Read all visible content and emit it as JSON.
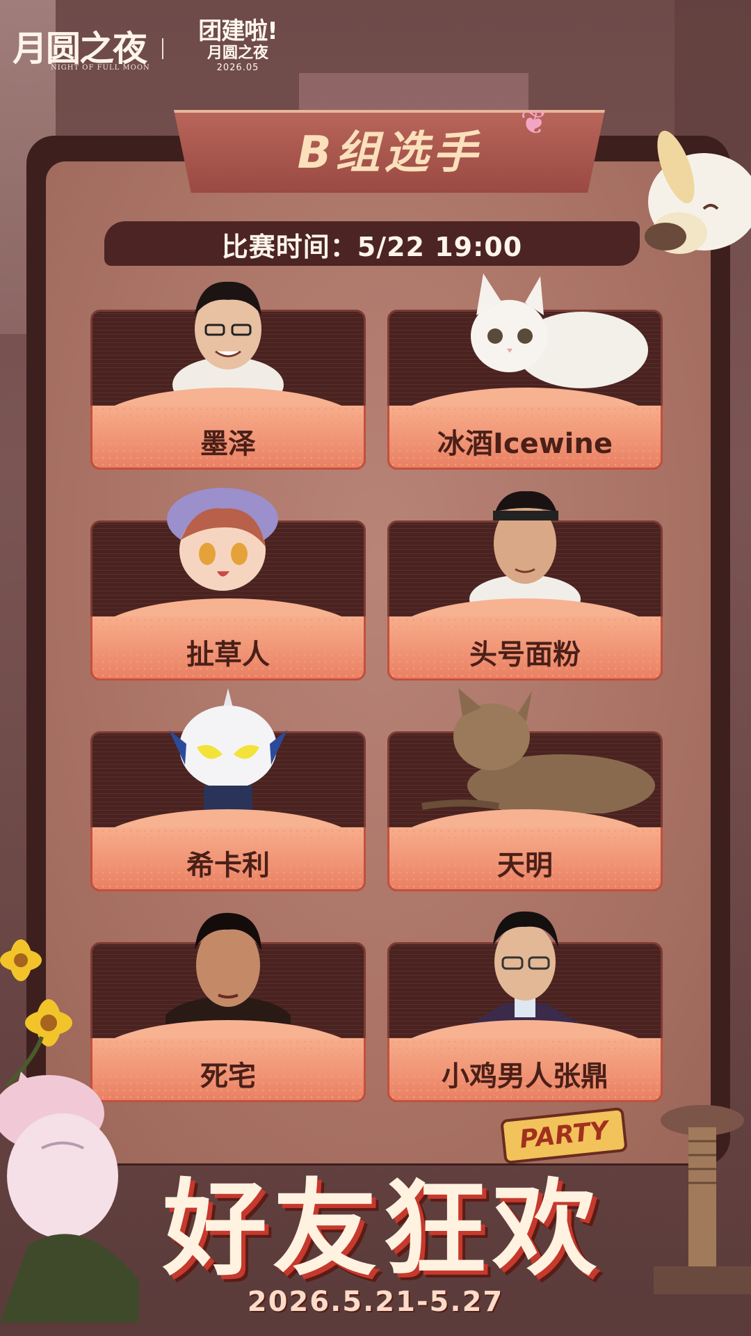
{
  "header": {
    "logo_left_title": "月圆之夜",
    "logo_left_subtitle": "NIGHT OF FULL MOON",
    "logo_right_line1": "团建啦!",
    "logo_right_line2": "月圆之夜",
    "logo_right_date": "2026.05"
  },
  "banner": {
    "title": "B组选手"
  },
  "match": {
    "time": "比赛时间：5/22 19:00"
  },
  "players": [
    {
      "name": "墨泽"
    },
    {
      "name": "冰酒Icewine"
    },
    {
      "name": "扯草人"
    },
    {
      "name": "头号面粉"
    },
    {
      "name": "希卡利"
    },
    {
      "name": "天明"
    },
    {
      "name": "死宅"
    },
    {
      "name": "小鸡男人张鼎"
    }
  ],
  "footer": {
    "party_label": "PARTY",
    "title": "好友狂欢",
    "dates": "2026.5.21-5.27"
  },
  "colors": {
    "board_dark": "#3d1f1e",
    "card_orange": "#ea8063",
    "name_text": "#4a1f18",
    "title_cream": "#fbe0bc"
  },
  "icons": [
    "butterfly-icon",
    "player-avatar-icon",
    "flower-icon",
    "cat-mascot-icon"
  ]
}
